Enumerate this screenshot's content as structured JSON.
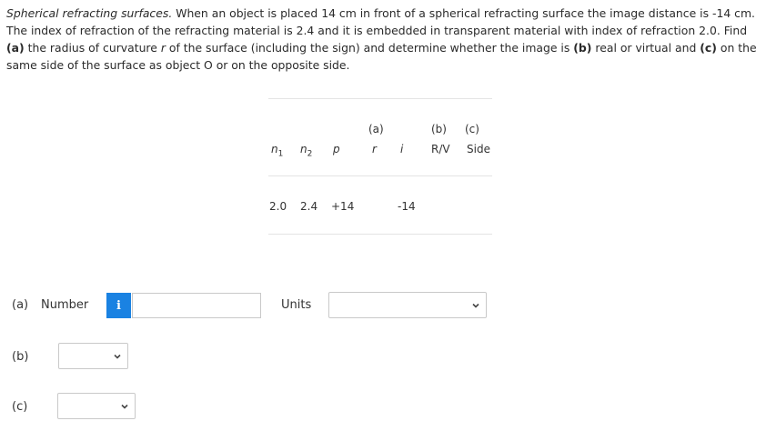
{
  "problem": {
    "title": "Spherical refracting surfaces.",
    "text_1": " When an object is placed 14 cm in front of a spherical refracting surface the image distance is -14 cm. The index of refraction of the refracting material is 2.4 and it is embedded in transparent material with index of refraction 2.0. Find ",
    "part_a": "(a)",
    "text_2": " the radius of curvature ",
    "r_var": "r",
    "text_3": " of the surface (including the sign) and determine whether the image is ",
    "part_b": "(b)",
    "text_4": " real or virtual and ",
    "part_c": "(c)",
    "text_5": " on the same side of the surface as object O or on the opposite side."
  },
  "table": {
    "headers_top": {
      "a": "(a)",
      "b": "(b)",
      "c": "(c)"
    },
    "headers": {
      "n1": "n",
      "n1_sub": "1",
      "n2": "n",
      "n2_sub": "2",
      "p": "p",
      "r": "r",
      "i": "i",
      "b": "R/V",
      "c": "Side"
    },
    "row": {
      "n1": "2.0",
      "n2": "2.4",
      "p": "+14",
      "r": "",
      "i": "-14",
      "b": "",
      "c": ""
    }
  },
  "answers": {
    "a_label": "(a)",
    "number_label": "Number",
    "info_icon": "i",
    "number_value": "",
    "units_label": "Units",
    "units_value": "",
    "b_label": "(b)",
    "b_value": "",
    "c_label": "(c)",
    "c_value": ""
  }
}
